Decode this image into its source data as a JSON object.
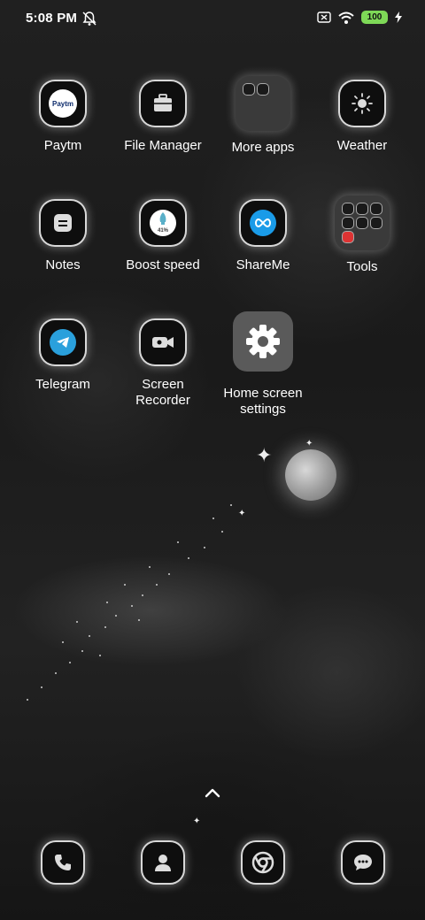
{
  "status_bar": {
    "time": "5:08 PM",
    "battery_level": "100",
    "icons": [
      "do-not-disturb-off-icon",
      "sim-missing-icon",
      "wifi-icon",
      "battery-icon",
      "charging-bolt-icon"
    ]
  },
  "apps": {
    "row1": [
      {
        "label": "Paytm",
        "icon": "paytm-logo",
        "logo_text": "Paytm"
      },
      {
        "label": "File Manager",
        "icon": "briefcase-icon"
      },
      {
        "label": "More apps",
        "icon": "folder-icon"
      },
      {
        "label": "Weather",
        "icon": "weather-sun-cloud-icon"
      }
    ],
    "row2": [
      {
        "label": "Notes",
        "icon": "notes-icon"
      },
      {
        "label": "Boost speed",
        "icon": "rocket-icon",
        "badge": "41%"
      },
      {
        "label": "ShareMe",
        "icon": "infinity-icon"
      },
      {
        "label": "Tools",
        "icon": "folder-icon"
      }
    ],
    "row3": [
      {
        "label": "Telegram",
        "icon": "telegram-icon"
      },
      {
        "label": "Screen\nRecorder",
        "icon": "video-camera-icon"
      },
      {
        "label": "Home screen settings",
        "icon": "gear-icon"
      }
    ]
  },
  "dock": [
    {
      "name": "Phone",
      "icon": "phone-icon"
    },
    {
      "name": "Contacts",
      "icon": "person-icon"
    },
    {
      "name": "Chrome",
      "icon": "chrome-icon"
    },
    {
      "name": "Messages",
      "icon": "chat-bubble-icon"
    }
  ],
  "colors": {
    "battery_green": "#7ed957",
    "shareme_blue": "#1a9be8",
    "telegram_blue": "#2aa0dc",
    "paytm_navy": "#0b2a6b"
  }
}
